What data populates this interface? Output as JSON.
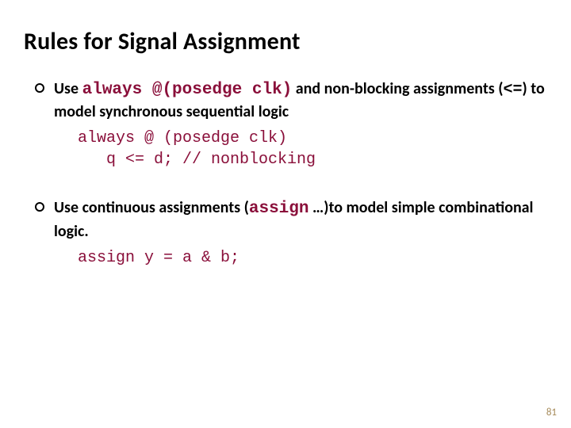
{
  "title": "Rules for Signal Assignment",
  "bullets": [
    {
      "prefix": "Use ",
      "code1": "always @(posedge clk)",
      "mid1": " and non-blocking assignments (",
      "op": "<=",
      "mid2": ") to model synchronous sequential logic",
      "code_block": "always @ (posedge clk)\n   q <= d; // nonblocking"
    },
    {
      "prefix": "Use continuous assignments (",
      "code1": "assign",
      "mid1": " …)to model simple combinational logic.",
      "op": "",
      "mid2": "",
      "code_block": "assign y = a & b;"
    }
  ],
  "page_number": "81"
}
